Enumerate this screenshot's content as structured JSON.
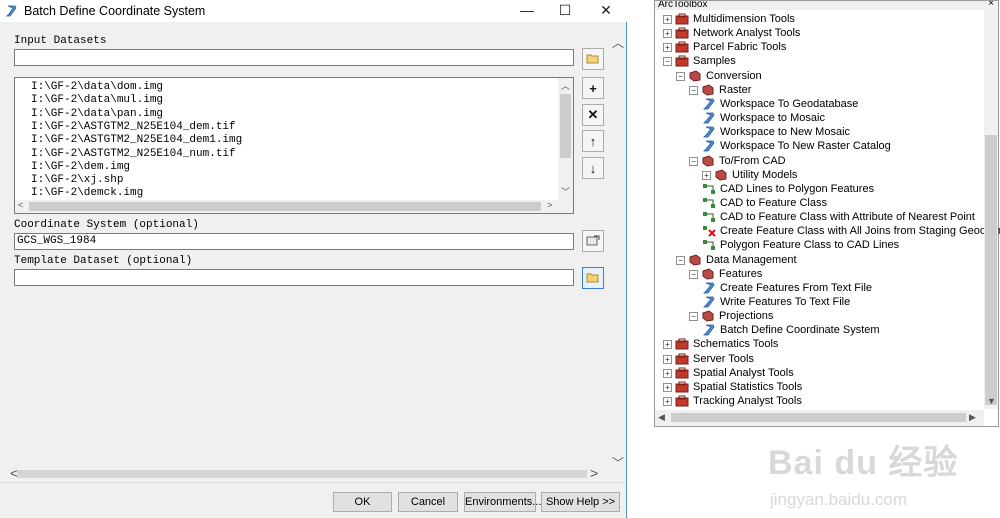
{
  "dialog": {
    "title": "Batch Define Coordinate System",
    "window_buttons": {
      "minimize": "—",
      "maximize": "☐",
      "close": "✕"
    },
    "input_datasets_label": "Input Datasets",
    "input_value": "",
    "datasets": [
      "I:\\GF-2\\data\\dom.img",
      "I:\\GF-2\\data\\mul.img",
      "I:\\GF-2\\data\\pan.img",
      "I:\\GF-2\\ASTGTM2_N25E104_dem.tif",
      "I:\\GF-2\\ASTGTM2_N25E104_dem1.img",
      "I:\\GF-2\\ASTGTM2_N25E104_num.tif",
      "I:\\GF-2\\dem.img",
      "I:\\GF-2\\xj.shp",
      "I:\\GF-2\\demck.img"
    ],
    "list_buttons": {
      "add": "+",
      "remove": "✕",
      "up": "↑",
      "down": "↓"
    },
    "coordinate_system_label": "Coordinate System (optional)",
    "coordinate_system_value": "GCS_WGS_1984",
    "template_dataset_label": "Template Dataset (optional)",
    "template_dataset_value": "",
    "buttons": {
      "ok": "OK",
      "cancel": "Cancel",
      "environments": "Environments...",
      "show_help": "Show Help >>"
    }
  },
  "toolbox": {
    "title": "ArcToolbox",
    "close": "×",
    "items": [
      {
        "label": "Multidimension Tools",
        "icon": "toolbox-icon",
        "expander": "+"
      },
      {
        "label": "Network Analyst Tools",
        "icon": "toolbox-icon",
        "expander": "+"
      },
      {
        "label": "Parcel Fabric Tools",
        "icon": "toolbox-icon",
        "expander": "+"
      },
      {
        "label": "Samples",
        "icon": "toolbox-icon",
        "expander": "−"
      },
      {
        "label": "Conversion",
        "icon": "toolset-icon",
        "expander": "−"
      },
      {
        "label": "Raster",
        "icon": "toolset-icon",
        "expander": "−"
      },
      {
        "label": "Workspace To Geodatabase",
        "icon": "script-icon",
        "expander": ""
      },
      {
        "label": "Workspace to Mosaic",
        "icon": "script-icon",
        "expander": ""
      },
      {
        "label": "Workspace to New Mosaic",
        "icon": "script-icon",
        "expander": ""
      },
      {
        "label": "Workspace To New Raster Catalog",
        "icon": "script-icon",
        "expander": ""
      },
      {
        "label": "To/From CAD",
        "icon": "toolset-icon",
        "expander": "−"
      },
      {
        "label": "Utility Models",
        "icon": "toolset-icon",
        "expander": "+"
      },
      {
        "label": "CAD Lines to Polygon Features",
        "icon": "model-icon",
        "expander": ""
      },
      {
        "label": "CAD to Feature Class",
        "icon": "model-icon",
        "expander": ""
      },
      {
        "label": "CAD to Feature Class with Attribute of Nearest Point",
        "icon": "model-icon",
        "expander": ""
      },
      {
        "label": "Create Feature Class with All Joins from Staging Geodatabase",
        "icon": "model-error-icon",
        "expander": ""
      },
      {
        "label": "Polygon Feature Class to CAD Lines",
        "icon": "model-icon",
        "expander": ""
      },
      {
        "label": "Data Management",
        "icon": "toolset-icon",
        "expander": "−"
      },
      {
        "label": "Features",
        "icon": "toolset-icon",
        "expander": "−"
      },
      {
        "label": "Create Features From Text File",
        "icon": "script-icon",
        "expander": ""
      },
      {
        "label": "Write Features To Text File",
        "icon": "script-icon",
        "expander": ""
      },
      {
        "label": "Projections",
        "icon": "toolset-icon",
        "expander": "−"
      },
      {
        "label": "Batch Define Coordinate System",
        "icon": "script-icon",
        "expander": ""
      },
      {
        "label": "Schematics Tools",
        "icon": "toolbox-icon",
        "expander": "+"
      },
      {
        "label": "Server Tools",
        "icon": "toolbox-icon",
        "expander": "+"
      },
      {
        "label": "Spatial Analyst Tools",
        "icon": "toolbox-icon",
        "expander": "+"
      },
      {
        "label": "Spatial Statistics Tools",
        "icon": "toolbox-icon",
        "expander": "+"
      },
      {
        "label": "Tracking Analyst Tools",
        "icon": "toolbox-icon",
        "expander": "+"
      }
    ]
  },
  "watermark": {
    "brand": "Bai du 经验",
    "url": "jingyan.baidu.com"
  }
}
